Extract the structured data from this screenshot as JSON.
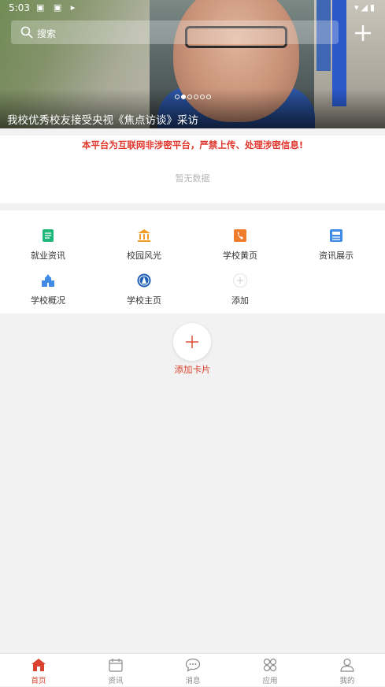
{
  "status_bar": {
    "time": "5:03"
  },
  "search": {
    "placeholder": "搜索"
  },
  "banner": {
    "caption": "我校优秀校友接受央视《焦点访谈》采访",
    "slide_count": 6,
    "active_slide": 1
  },
  "notice": {
    "warning": "本平台为互联网非涉密平台，严禁上传、处理涉密信息!",
    "empty": "暂无数据"
  },
  "grid": {
    "items": [
      {
        "label": "就业资讯",
        "icon": "document-icon",
        "color": "#20b87a"
      },
      {
        "label": "校园风光",
        "icon": "institution-icon",
        "color": "#f29b2b"
      },
      {
        "label": "学校黄页",
        "icon": "phone-book-icon",
        "color": "#f07d2e"
      },
      {
        "label": "资讯展示",
        "icon": "news-icon",
        "color": "#3f8be6"
      },
      {
        "label": "学校概况",
        "icon": "school-building-icon",
        "color": "#3f8be6"
      },
      {
        "label": "学校主页",
        "icon": "school-emblem-icon",
        "color": "#1f5fb8"
      },
      {
        "label": "添加",
        "icon": "add-icon",
        "color": "#cccccc"
      }
    ]
  },
  "add_card": {
    "label": "添加卡片"
  },
  "bottom_nav": {
    "items": [
      {
        "label": "首页",
        "icon": "home-icon",
        "active": true
      },
      {
        "label": "资讯",
        "icon": "calendar-icon",
        "active": false
      },
      {
        "label": "消息",
        "icon": "chat-icon",
        "active": false
      },
      {
        "label": "应用",
        "icon": "apps-icon",
        "active": false
      },
      {
        "label": "我的",
        "icon": "user-icon",
        "active": false
      }
    ]
  },
  "colors": {
    "accent": "#d9432f",
    "warning": "#e0352b"
  }
}
